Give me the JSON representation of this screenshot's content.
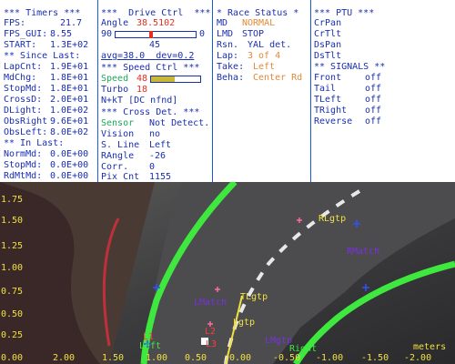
{
  "timers": {
    "header": "*** Timers ***",
    "fps_label": "FPS:",
    "fps_value": "21.7",
    "fps_gui_label": "FPS_GUI:",
    "fps_gui_value": "8.55",
    "start_label": "START:",
    "start_value": "1.3E+02",
    "since_last_header": "** Since Last:",
    "rows": [
      {
        "label": "LapCnt:",
        "value": "1.9E+01"
      },
      {
        "label": "MdChg:",
        "value": "1.8E+01"
      },
      {
        "label": "StopMd:",
        "value": "1.8E+01"
      },
      {
        "label": "CrossD:",
        "value": "2.0E+01"
      },
      {
        "label": "DLight:",
        "value": "1.0E+02"
      },
      {
        "label": "ObsRight",
        "value": "9.6E+01"
      },
      {
        "label": "ObsLeft:",
        "value": "8.0E+02"
      }
    ],
    "in_last_header": "** In Last:",
    "in_last_rows": [
      {
        "label": "NormMd:",
        "value": "0.0E+00"
      },
      {
        "label": "StopMd:",
        "value": "0.0E+00"
      },
      {
        "label": "RdMtMd:",
        "value": "0.0E+00"
      }
    ]
  },
  "drive": {
    "header": "***  Drive Ctrl  ***",
    "angle_label": "Angle",
    "angle_value": "38.5102",
    "slider_min": "90",
    "slider_max": "0",
    "slider_center": "45",
    "angle_level": 0.43,
    "avg_text": "avg=38.0  dev=0.2",
    "speed_header": "*** Speed Ctrl ***",
    "speed_label": "Speed",
    "speed_value": "48",
    "speed_level": 0.48,
    "turbo_label": "Turbo",
    "turbo_value": "18",
    "mode_text": "N+kT [DC nfnd]",
    "cross_header": "*** Cross Det. ***",
    "cross_rows": [
      {
        "label": "Sensor",
        "value": "Not Detect."
      },
      {
        "label": "Vision",
        "value": "no"
      },
      {
        "label": "S. Line",
        "value": "Left"
      },
      {
        "label": "RAngle",
        "value": "-26"
      },
      {
        "label": "Corr.",
        "value": "0"
      },
      {
        "label": "Pix Cnt",
        "value": "1155"
      }
    ]
  },
  "race": {
    "header": "* Race Status *",
    "rows": [
      {
        "label": "MD",
        "value": "NORMAL"
      },
      {
        "label": "LMD",
        "value": "STOP"
      },
      {
        "label": "Rsn.",
        "value": "YAL det."
      },
      {
        "label": "Lap:",
        "value": "3 of 4"
      },
      {
        "label": "Take:",
        "value": "Left"
      },
      {
        "label": "Beha:",
        "value": "Center Rd"
      }
    ]
  },
  "ptu": {
    "header": "*** PTU ***",
    "items": [
      "CrPan",
      "CrTlt",
      "DsPan",
      "DsTlt"
    ],
    "signals_header": "** SIGNALS **",
    "signals": [
      {
        "label": "Front",
        "value": "off"
      },
      {
        "label": "Tail",
        "value": "off"
      },
      {
        "label": "TLeft",
        "value": "off"
      },
      {
        "label": "TRight",
        "value": "off"
      },
      {
        "label": "Reverse",
        "value": "off"
      }
    ]
  },
  "camera": {
    "y_ticks": [
      "1.75",
      "1.50",
      "1.25",
      "1.00",
      "0.75",
      "0.50",
      "0.25",
      "0.00"
    ],
    "x_ticks": [
      "2.00",
      "1.50",
      "1.00",
      "0.50",
      "0.00",
      "-0.50",
      "-1.00",
      "-1.50",
      "-2.00"
    ],
    "unit_label": "meters",
    "overlay_labels": {
      "left": "Left",
      "right": "Right",
      "lmatch": "LMatch",
      "rmatch": "RMatch",
      "rlgtp": "RLgtp",
      "tlgtp": "TLgtp",
      "lgtp": "Lgtp",
      "lmgtp": "LMgtp",
      "l1": "L1",
      "l2": "L2",
      "l3": "L3"
    },
    "colors": {
      "lane_green": "#3ee83e",
      "label_yellow": "#f0e040",
      "marker_purple": "#7a30e0",
      "marker_blue": "#3050ff",
      "marker_pink": "#ff6aa0"
    }
  }
}
